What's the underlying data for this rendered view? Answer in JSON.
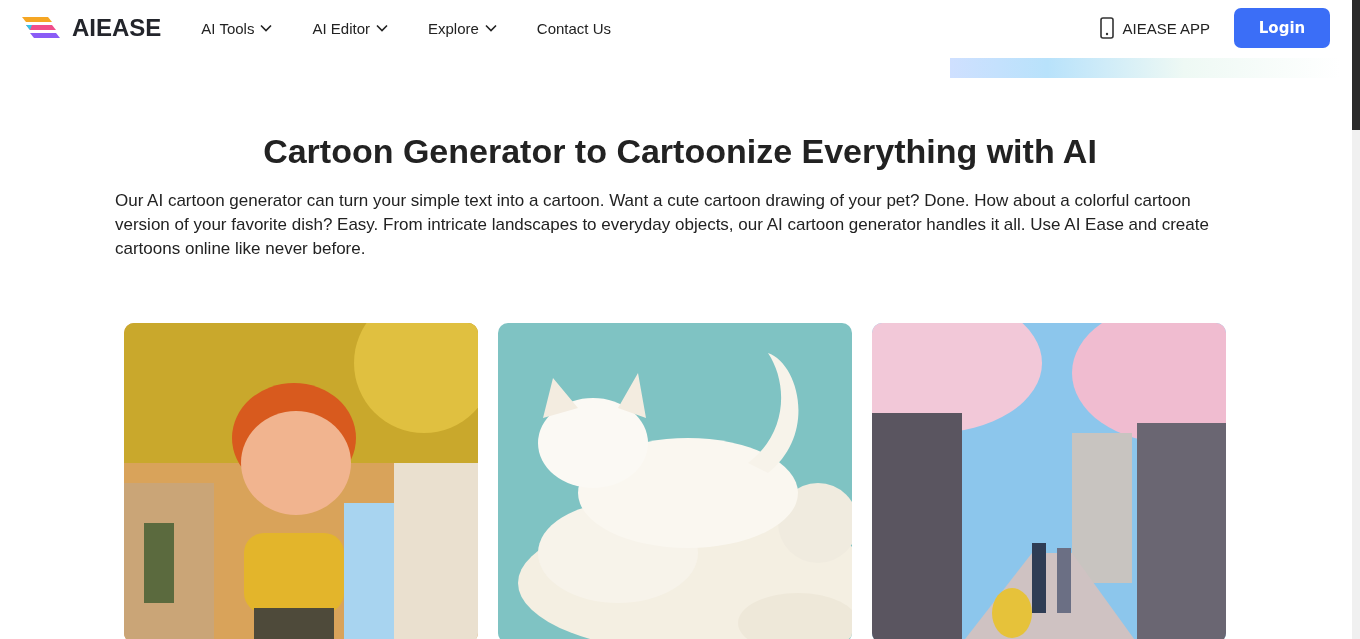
{
  "header": {
    "logo": "AIEASE",
    "nav": [
      {
        "label": "AI Tools",
        "dropdown": true
      },
      {
        "label": "AI Editor",
        "dropdown": true
      },
      {
        "label": "Explore",
        "dropdown": true
      },
      {
        "label": "Contact Us",
        "dropdown": false
      }
    ],
    "app_link": "AIEASE APP",
    "login": "Login"
  },
  "hero": {
    "title": "Cartoon Generator to Cartoonize Everything with AI",
    "description": "Our AI cartoon generator can turn your simple text into a cartoon. Want a cute cartoon drawing of your pet? Done. How about a colorful cartoon version of your favorite dish? Easy. From intricate landscapes to everyday objects, our AI cartoon generator handles it all. Use AI Ease and create cartoons online like never before."
  },
  "gallery": [
    {
      "kind": "boy"
    },
    {
      "kind": "cat"
    },
    {
      "kind": "street"
    }
  ]
}
